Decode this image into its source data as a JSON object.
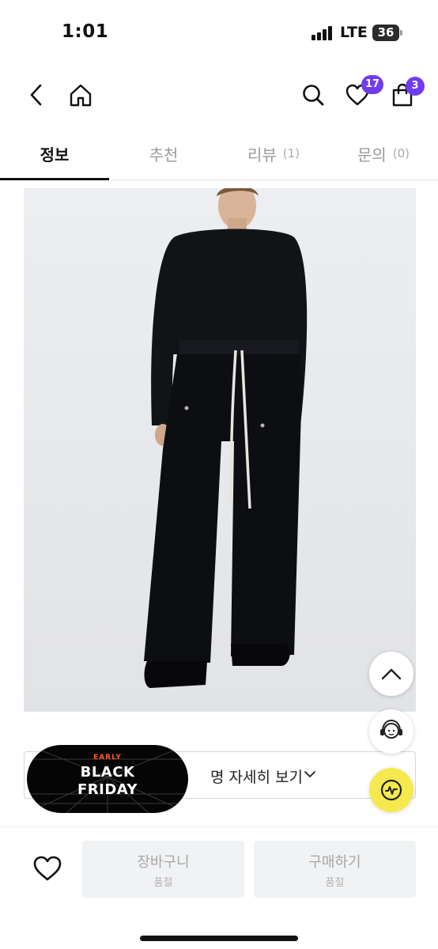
{
  "status_bar": {
    "time": "1:01",
    "network": "LTE",
    "battery": "36"
  },
  "nav": {
    "back_icon": "chevron-left-icon",
    "home_icon": "home-icon",
    "search_icon": "search-icon",
    "wishlist_icon": "heart-icon",
    "wishlist_count": "17",
    "cart_icon": "shopping-bag-icon",
    "cart_count": "3"
  },
  "tabs": [
    {
      "label": "정보",
      "count": "",
      "active": true
    },
    {
      "label": "추천",
      "count": ""
    },
    {
      "label": "리뷰",
      "count": "(1)"
    },
    {
      "label": "문의",
      "count": "(0)"
    }
  ],
  "product": {
    "image_icon": "product-photo"
  },
  "detail_button": {
    "label": "명 자세히 보기"
  },
  "promo_banner": {
    "line_small": "EARLY",
    "line1": "BLACK",
    "line2": "FRIDAY"
  },
  "floating": {
    "scroll_top_icon": "chevron-up-icon",
    "support_icon": "customer-support-icon",
    "voice_icon": "audio-wave-icon"
  },
  "bottom_bar": {
    "wishlist_icon": "heart-outline-icon",
    "cart": {
      "label": "장바구니",
      "status": "품절"
    },
    "buy": {
      "label": "구매하기",
      "status": "품절"
    }
  },
  "colors": {
    "accent": "#6f3cf0",
    "fab_yellow": "#f5e94e",
    "disabled_bg": "#f1f2f4"
  }
}
